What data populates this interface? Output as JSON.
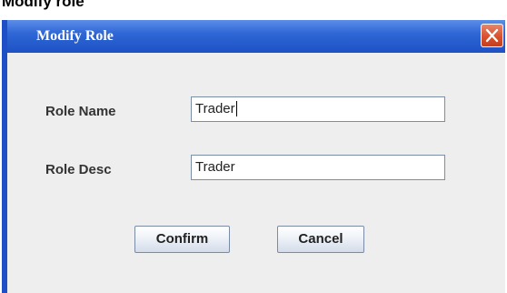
{
  "caption": "Modify role",
  "dialog": {
    "title": "Modify Role",
    "close_icon": "close-icon",
    "accent_color": "#2f67d6",
    "close_color": "#d8512f"
  },
  "form": {
    "role_name_label": "Role Name",
    "role_name_value": "Trader",
    "role_desc_label": "Role Desc",
    "role_desc_value": "Trader"
  },
  "buttons": {
    "confirm_label": "Confirm",
    "cancel_label": "Cancel"
  }
}
